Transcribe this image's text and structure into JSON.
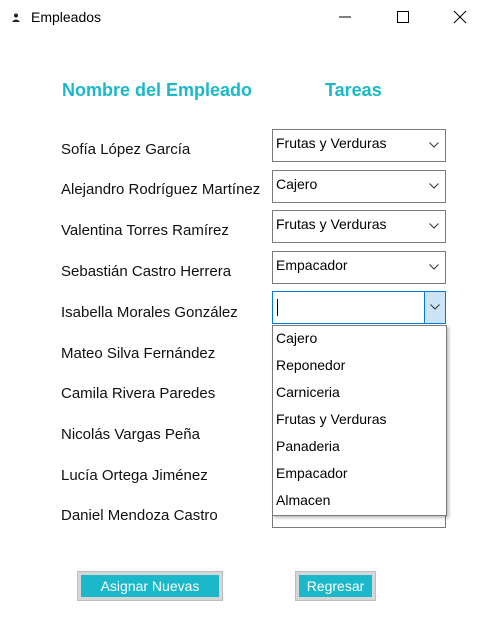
{
  "window": {
    "title": "Empleados"
  },
  "headers": {
    "name": "Nombre del Empleado",
    "tasks": "Tareas"
  },
  "employees": [
    {
      "name": "Sofía López García",
      "task": "Frutas y Verduras"
    },
    {
      "name": "Alejandro Rodríguez Martínez",
      "task": "Cajero"
    },
    {
      "name": "Valentina Torres Ramírez",
      "task": "Frutas y Verduras"
    },
    {
      "name": "Sebastián Castro Herrera",
      "task": "Empacador"
    },
    {
      "name": "Isabella Morales González",
      "task": ""
    },
    {
      "name": "Mateo Silva Fernández",
      "task": ""
    },
    {
      "name": "Camila Rivera Paredes",
      "task": ""
    },
    {
      "name": "Nicolás Vargas Peña",
      "task": ""
    },
    {
      "name": "Lucía Ortega Jiménez",
      "task": ""
    },
    {
      "name": "Daniel Mendoza Castro",
      "task": ""
    }
  ],
  "dropdown_options": [
    "Cajero",
    "Reponedor",
    "Carniceria",
    "Frutas y Verduras",
    "Panaderia",
    "Empacador",
    "Almacen"
  ],
  "buttons": {
    "assign": "Asignar Nuevas",
    "back": "Regresar"
  },
  "colors": {
    "accent": "#1ab8c9",
    "focus_border": "#0078d7",
    "dropdown_button": "#cce4f7"
  },
  "icons": {
    "app": "app-icon",
    "minimize": "minimize-icon",
    "maximize": "maximize-icon",
    "close": "close-icon",
    "dropdown": "chevron-down-icon"
  }
}
